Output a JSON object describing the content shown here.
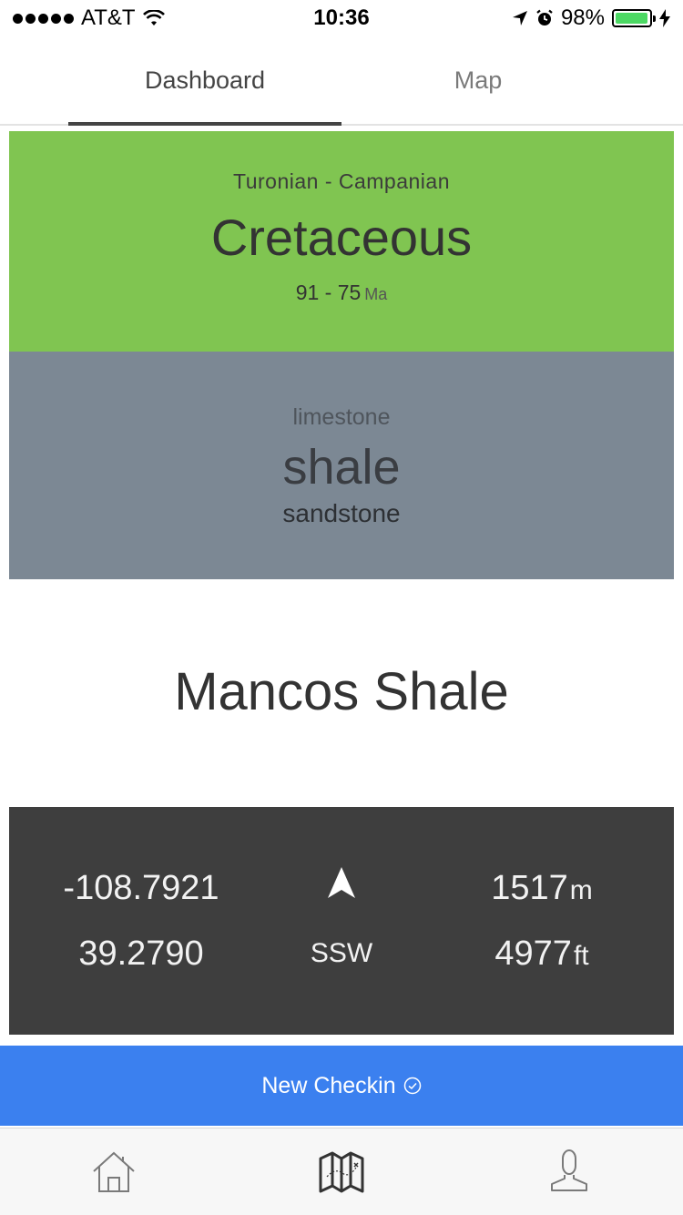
{
  "status_bar": {
    "carrier": "AT&T",
    "time": "10:36",
    "battery": "98%",
    "battery_level": 0.98,
    "battery_color": "#4cd964"
  },
  "tabs": [
    {
      "label": "Dashboard",
      "active": true
    },
    {
      "label": "Map",
      "active": false
    }
  ],
  "period": {
    "stages": "Turonian - Campanian",
    "name": "Cretaceous",
    "age_range": "91 - 75",
    "age_unit": "Ma",
    "color": "#80c551"
  },
  "lithology": {
    "minor_above": "limestone",
    "major": "shale",
    "minor_below": "sandstone",
    "color": "#7c8894"
  },
  "formation": {
    "name": "Mancos Shale"
  },
  "location": {
    "longitude": "-108.7921",
    "latitude": "39.2790",
    "heading_icon": "navigation-arrow-icon",
    "heading": "SSW",
    "elevation_m": "1517",
    "elevation_m_unit": "m",
    "elevation_ft": "4977",
    "elevation_ft_unit": "ft"
  },
  "checkin_button": {
    "label": "New Checkin",
    "icon": "check-circle-icon",
    "color": "#3b80ef"
  },
  "bottom_nav": [
    {
      "icon": "home-icon"
    },
    {
      "icon": "map-icon",
      "active": true
    },
    {
      "icon": "user-icon"
    }
  ]
}
